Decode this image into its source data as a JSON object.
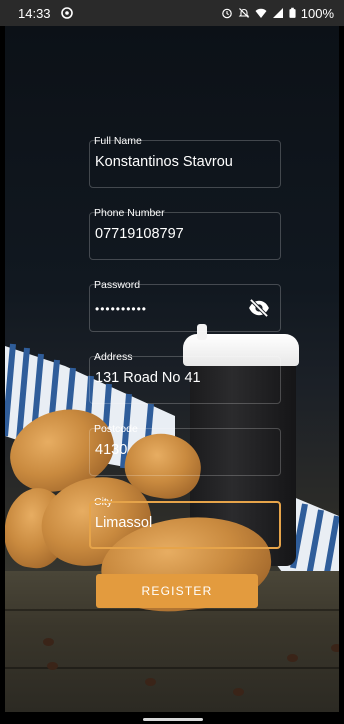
{
  "status_bar": {
    "time": "14:33",
    "battery": "100%",
    "icons": [
      "alarm-icon",
      "mute-icon",
      "wifi-icon",
      "signal-icon",
      "battery-icon"
    ]
  },
  "form": {
    "full_name": {
      "label": "Full Name",
      "value": "Konstantinos Stavrou"
    },
    "phone": {
      "label": "Phone Number",
      "value": "07719108797"
    },
    "password": {
      "label": "Password",
      "value": "••••••••••"
    },
    "address": {
      "label": "Address",
      "value": "131 Road No 41"
    },
    "postcode": {
      "label": "Postcode",
      "value": "4130"
    },
    "city": {
      "label": "City",
      "value": "Limassol"
    }
  },
  "register_label": "REGISTER",
  "colors": {
    "accent": "#e39b3e",
    "text": "#ffffff"
  }
}
